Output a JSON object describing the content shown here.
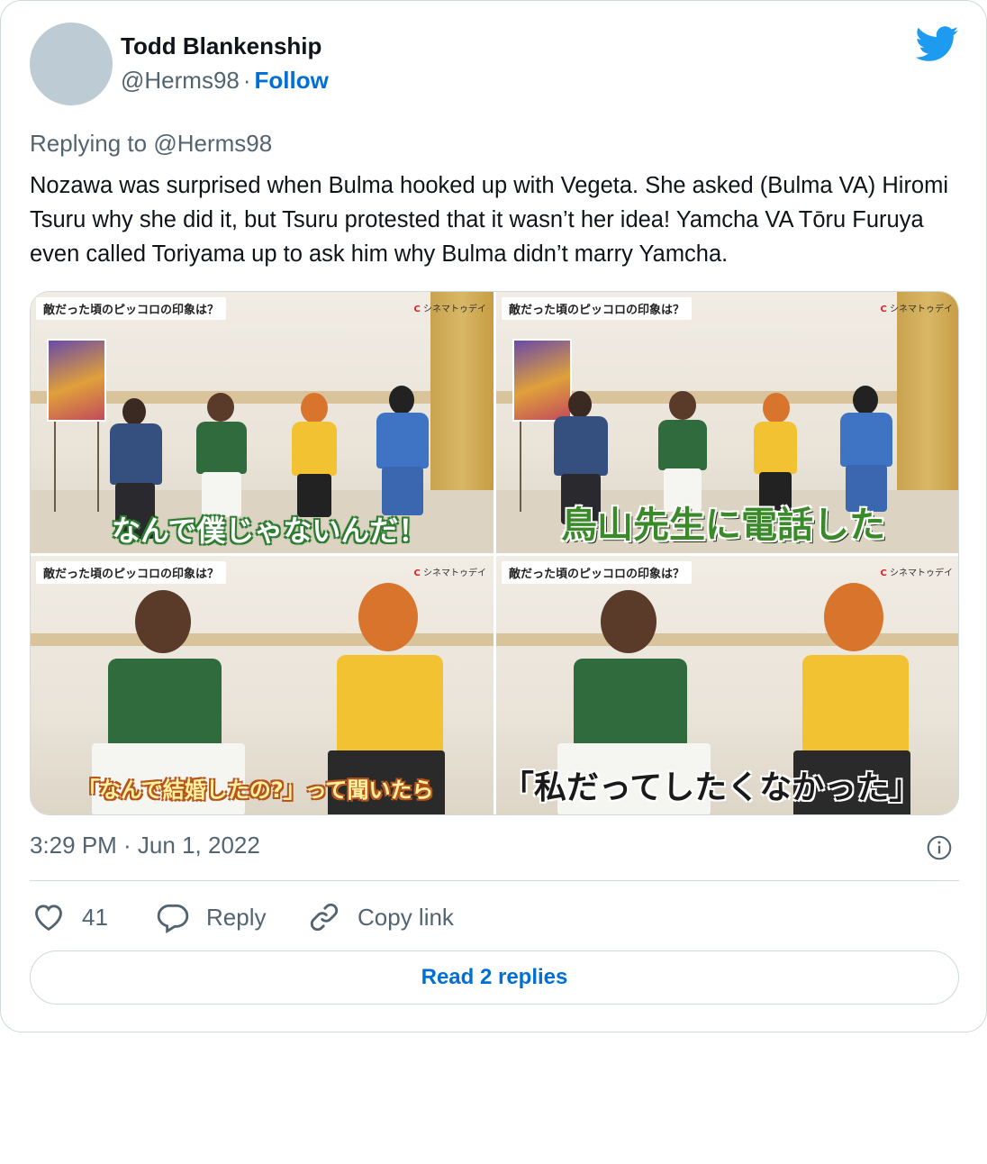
{
  "author": {
    "name": "Todd Blankenship",
    "handle": "@Herms98",
    "separator": "·",
    "follow_label": "Follow"
  },
  "reply_context": {
    "prefix": "Replying to",
    "handle": "@Herms98"
  },
  "tweet_text": "Nozawa was surprised when Bulma hooked up with Vegeta. She asked (Bulma VA) Hiromi Tsuru why she did it, but Tsuru protested that it wasn’t her idea! Yamcha VA Tōru Furuya even called Toriyama up to ask him why Bulma didn’t marry Yamcha.",
  "media": [
    {
      "label": "敵だった頃のピッコロの印象は？",
      "brand_mark": "C",
      "brand": "シネマトゥデイ",
      "caption": "なんで僕じゃないんだ！"
    },
    {
      "label": "敵だった頃のピッコロの印象は？",
      "brand_mark": "C",
      "brand": "シネマトゥデイ",
      "caption": "鳥山先生に電話した"
    },
    {
      "label": "敵だった頃のピッコロの印象は？",
      "brand_mark": "C",
      "brand": "シネマトゥデイ",
      "caption": "「なんで結婚したの?」って聞いたら"
    },
    {
      "label": "敵だった頃のピッコロの印象は？",
      "brand_mark": "C",
      "brand": "シネマトゥデイ",
      "caption": "「私だってしたくなかった」"
    }
  ],
  "timestamp": "3:29 PM · Jun 1, 2022",
  "actions": {
    "like_count": "41",
    "reply_label": "Reply",
    "copy_label": "Copy link"
  },
  "read_replies_label": "Read 2 replies",
  "colors": {
    "twitter_blue": "#1d9bf0",
    "link_blue": "#006fd6",
    "secondary_text": "#536471",
    "border": "#cfd9de"
  },
  "icons": [
    "twitter-bird-icon",
    "info-icon",
    "heart-icon",
    "reply-bubble-icon",
    "link-icon"
  ]
}
